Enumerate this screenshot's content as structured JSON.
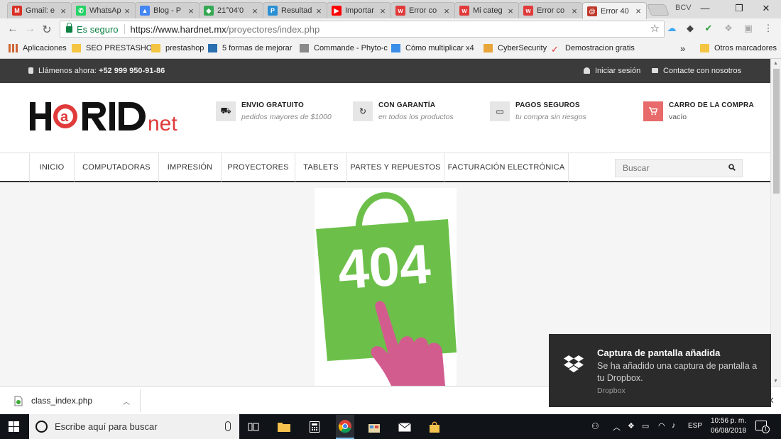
{
  "browser": {
    "tabs": [
      {
        "title": "Gmail: e",
        "icon": "gmail-icon",
        "color": "#d93025",
        "glyph": "M"
      },
      {
        "title": "WhatsAp",
        "icon": "whatsapp-icon",
        "color": "#25d366",
        "glyph": "✆"
      },
      {
        "title": "Blog - P",
        "icon": "blogger-icon",
        "color": "#4285f4",
        "glyph": "▲"
      },
      {
        "title": "21°04'0",
        "icon": "maps-icon",
        "color": "#34a853",
        "glyph": "◆"
      },
      {
        "title": "Resultad",
        "icon": "prestashop-icon",
        "color": "#2a8fd4",
        "glyph": "P"
      },
      {
        "title": "Importar",
        "icon": "youtube-icon",
        "color": "#ff0000",
        "glyph": "▶"
      },
      {
        "title": "Error co",
        "icon": "site-icon",
        "color": "#e03a3a",
        "glyph": "w"
      },
      {
        "title": "Mi categ",
        "icon": "site-icon",
        "color": "#e03a3a",
        "glyph": "w"
      },
      {
        "title": "Error co",
        "icon": "site-icon",
        "color": "#e03a3a",
        "glyph": "w"
      },
      {
        "title": "Error 40",
        "icon": "hardnet-icon",
        "color": "#c0392b",
        "glyph": "@",
        "active": true
      }
    ],
    "profile_label": "BCV",
    "window_controls": {
      "minimize": "—",
      "maximize": "❐",
      "close": "✕"
    },
    "secure_label": "Es seguro",
    "url_host": "https://www.hardnet.mx",
    "url_path": "/proyectores/index.php",
    "bookmarks": [
      {
        "label": "Aplicaciones",
        "icon": "apps-grid-icon"
      },
      {
        "label": "SEO PRESTASHOP",
        "icon": "folder-icon"
      },
      {
        "label": "prestashop",
        "icon": "folder-icon"
      },
      {
        "label": "5 formas de mejorar",
        "icon": "blog-icon"
      },
      {
        "label": "Commande - Phyto-c",
        "icon": "page-icon"
      },
      {
        "label": "Cómo multiplicar x4",
        "icon": "google-icon"
      },
      {
        "label": "CyberSecurity",
        "icon": "windows-icon"
      },
      {
        "label": "Demostracion gratis",
        "icon": "check-icon"
      }
    ],
    "bookmarks_more": "»",
    "other_bookmarks": "Otros marcadores"
  },
  "site": {
    "topbar": {
      "phone_prefix": "Llámenos ahora:",
      "phone": "+52 999 950-91-86",
      "login": "Iniciar sesión",
      "contact": "Contacte con nosotros"
    },
    "features": [
      {
        "title": "ENVIO GRATUITO",
        "subtitle": "pedidos mayores de $1000",
        "icon": "truck-icon",
        "glyph": "⛟"
      },
      {
        "title": "CON GARANTÍA",
        "subtitle": "en todos los productos",
        "icon": "refresh-icon",
        "glyph": "↻"
      },
      {
        "title": "PAGOS SEGUROS",
        "subtitle": "tu compra sin riesgos",
        "icon": "credit-card-icon",
        "glyph": "▭"
      }
    ],
    "cart": {
      "title": "CARRO DE LA COMPRA",
      "status": "vacío",
      "icon": "cart-icon"
    },
    "menu": [
      "INICIO",
      "COMPUTADORAS",
      "IMPRESIÓN",
      "PROYECTORES",
      "TABLETS",
      "PARTES Y REPUESTOS",
      "FACTURACIÓN ELECTRÓNICA"
    ],
    "search_placeholder": "Buscar",
    "error_number": "404",
    "colors": {
      "accent": "#e86a6a",
      "bag_green": "#6cc04a",
      "hand_pink": "#d35c8f"
    }
  },
  "downloads": {
    "file": "class_index.php"
  },
  "toast": {
    "title": "Captura de pantalla añadida",
    "message": "Se ha añadido una captura de pantalla a tu Dropbox.",
    "source": "Dropbox"
  },
  "taskbar": {
    "search_placeholder": "Escribe aquí para buscar",
    "language": "ESP",
    "time": "10:56 p. m.",
    "date": "06/08/2018",
    "notification_count": "1"
  }
}
